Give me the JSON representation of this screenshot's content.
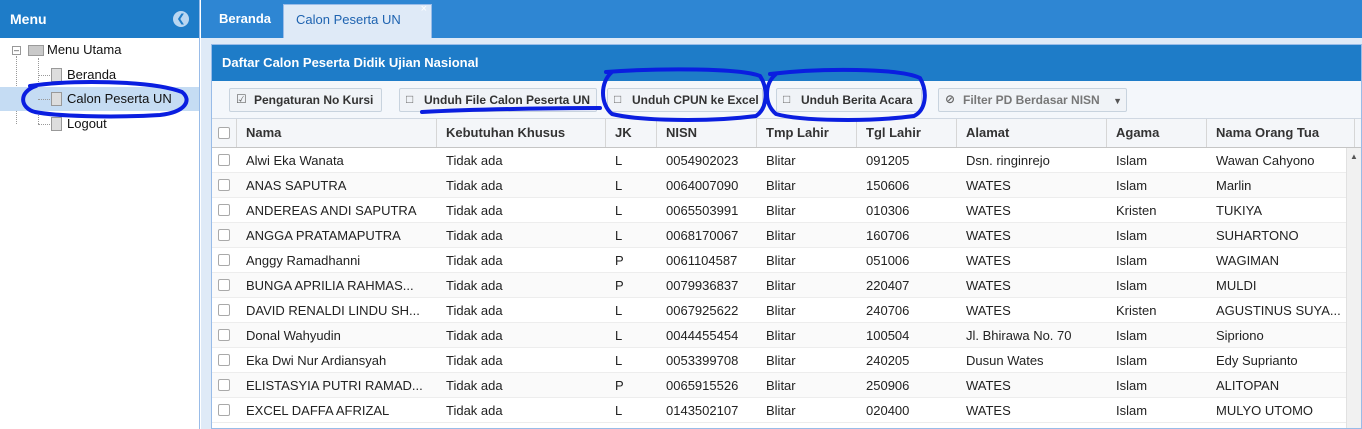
{
  "menu": {
    "title": "Menu",
    "collapse_icon": "chevron-left-icon",
    "items": [
      {
        "label": "Menu Utama"
      },
      {
        "label": "Beranda"
      },
      {
        "label": "Calon Peserta UN"
      },
      {
        "label": "Logout"
      }
    ]
  },
  "tabs": [
    {
      "label": "Beranda"
    },
    {
      "label": "Calon Peserta UN",
      "close": "×"
    }
  ],
  "panel": {
    "title": "Daftar Calon Peserta Didik Ujian Nasional",
    "toolbar": [
      {
        "label": "Pengaturan No Kursi",
        "icon": "checkbox-icon"
      },
      {
        "label": "Unduh File Calon Peserta UN",
        "icon": "download-tray-icon"
      },
      {
        "label": "Unduh CPUN ke Excel",
        "icon": "download-tray-icon"
      },
      {
        "label": "Unduh Berita Acara",
        "icon": "download-tray-icon"
      },
      {
        "label": "Filter PD Berdasar NISN",
        "icon": "eye-off-icon"
      }
    ]
  },
  "grid": {
    "columns": [
      "Nama",
      "Kebutuhan Khusus",
      "JK",
      "NISN",
      "Tmp Lahir",
      "Tgl Lahir",
      "Alamat",
      "Agama",
      "Nama Orang Tua"
    ],
    "rows": [
      [
        "Alwi Eka Wanata",
        "Tidak ada",
        "L",
        "0054902023",
        "Blitar",
        "091205",
        "Dsn. ringinrejo",
        "Islam",
        "Wawan Cahyono"
      ],
      [
        "ANAS SAPUTRA",
        "Tidak ada",
        "L",
        "0064007090",
        "Blitar",
        "150606",
        "WATES",
        "Islam",
        "Marlin"
      ],
      [
        "ANDEREAS ANDI SAPUTRA",
        "Tidak ada",
        "L",
        "0065503991",
        "Blitar",
        "010306",
        "WATES",
        "Kristen",
        "TUKIYA"
      ],
      [
        "ANGGA PRATAMAPUTRA",
        "Tidak ada",
        "L",
        "0068170067",
        "Blitar",
        "160706",
        "WATES",
        "Islam",
        "SUHARTONO"
      ],
      [
        "Anggy Ramadhanni",
        "Tidak ada",
        "P",
        "0061104587",
        "Blitar",
        "051006",
        "WATES",
        "Islam",
        "WAGIMAN"
      ],
      [
        "BUNGA APRILIA RAHMAS...",
        "Tidak ada",
        "P",
        "0079936837",
        "Blitar",
        "220407",
        "WATES",
        "Islam",
        "MULDI"
      ],
      [
        "DAVID RENALDI LINDU SH...",
        "Tidak ada",
        "L",
        "0067925622",
        "Blitar",
        "240706",
        "WATES",
        "Kristen",
        "AGUSTINUS SUYA..."
      ],
      [
        "Donal Wahyudin",
        "Tidak ada",
        "L",
        "0044455454",
        "Blitar",
        "100504",
        "Jl. Bhirawa No. 70",
        "Islam",
        "Sipriono"
      ],
      [
        "Eka Dwi Nur Ardiansyah",
        "Tidak ada",
        "L",
        "0053399708",
        "Blitar",
        "240205",
        "Dusun Wates",
        "Islam",
        "Edy Suprianto"
      ],
      [
        "ELISTASYIA PUTRI RAMAD...",
        "Tidak ada",
        "P",
        "0065915526",
        "Blitar",
        "250906",
        "WATES",
        "Islam",
        "ALITOPAN"
      ],
      [
        "EXCEL DAFFA AFRIZAL",
        "Tidak ada",
        "L",
        "0143502107",
        "Blitar",
        "020400",
        "WATES",
        "Islam",
        "MULYO UTOMO"
      ]
    ]
  },
  "colors": {
    "header_blue": "#1e7cc8",
    "tabbar_blue": "#2e86d3",
    "selected_row": "#c5dcf3",
    "annotation_ink": "#0a1ee0"
  }
}
